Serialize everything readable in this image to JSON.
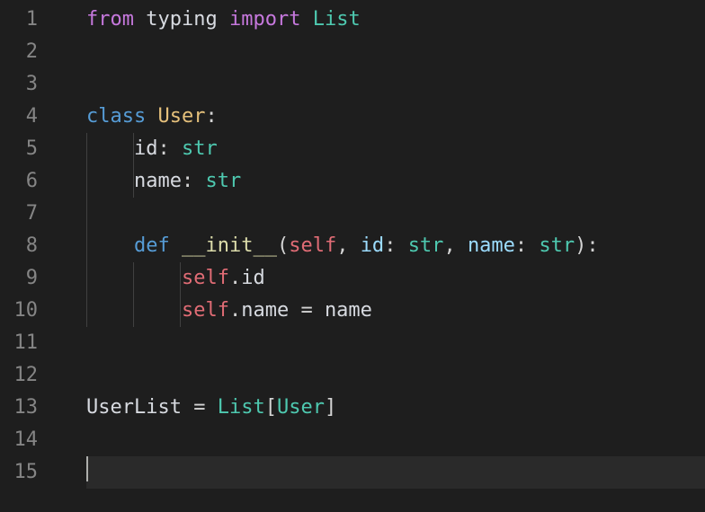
{
  "editor": {
    "line_count": 15,
    "cursor_line": 15,
    "lines": {
      "l1": {
        "from": "from",
        "sp1": " ",
        "mod": "typing",
        "sp2": " ",
        "import": "import",
        "sp3": " ",
        "what": "List"
      },
      "l4": {
        "kw": "class",
        "sp": " ",
        "name": "User",
        "colon": ":"
      },
      "l5": {
        "field": "id",
        "colon": ":",
        "sp": " ",
        "type": "str"
      },
      "l6": {
        "field": "name",
        "colon": ":",
        "sp": " ",
        "type": "str"
      },
      "l8": {
        "kw": "def",
        "sp": " ",
        "fn": "__init__",
        "lp": "(",
        "self": "self",
        "c1": ",",
        "sp2": " ",
        "p1": "id",
        "pc1": ":",
        "psp1": " ",
        "pt1": "str",
        "c2": ",",
        "sp3": " ",
        "p2": "name",
        "pc2": ":",
        "psp2": " ",
        "pt2": "str",
        "rp": ")",
        "colon": ":"
      },
      "l9": {
        "self": "self",
        "dot": ".",
        "prop": "id"
      },
      "l10": {
        "self": "self",
        "dot": ".",
        "prop": "name",
        "sp1": " ",
        "eq": "=",
        "sp2": " ",
        "val": "name"
      },
      "l13": {
        "name": "UserList",
        "sp1": " ",
        "eq": "=",
        "sp2": " ",
        "list": "List",
        "lb": "[",
        "inner": "User",
        "rb": "]"
      }
    }
  }
}
